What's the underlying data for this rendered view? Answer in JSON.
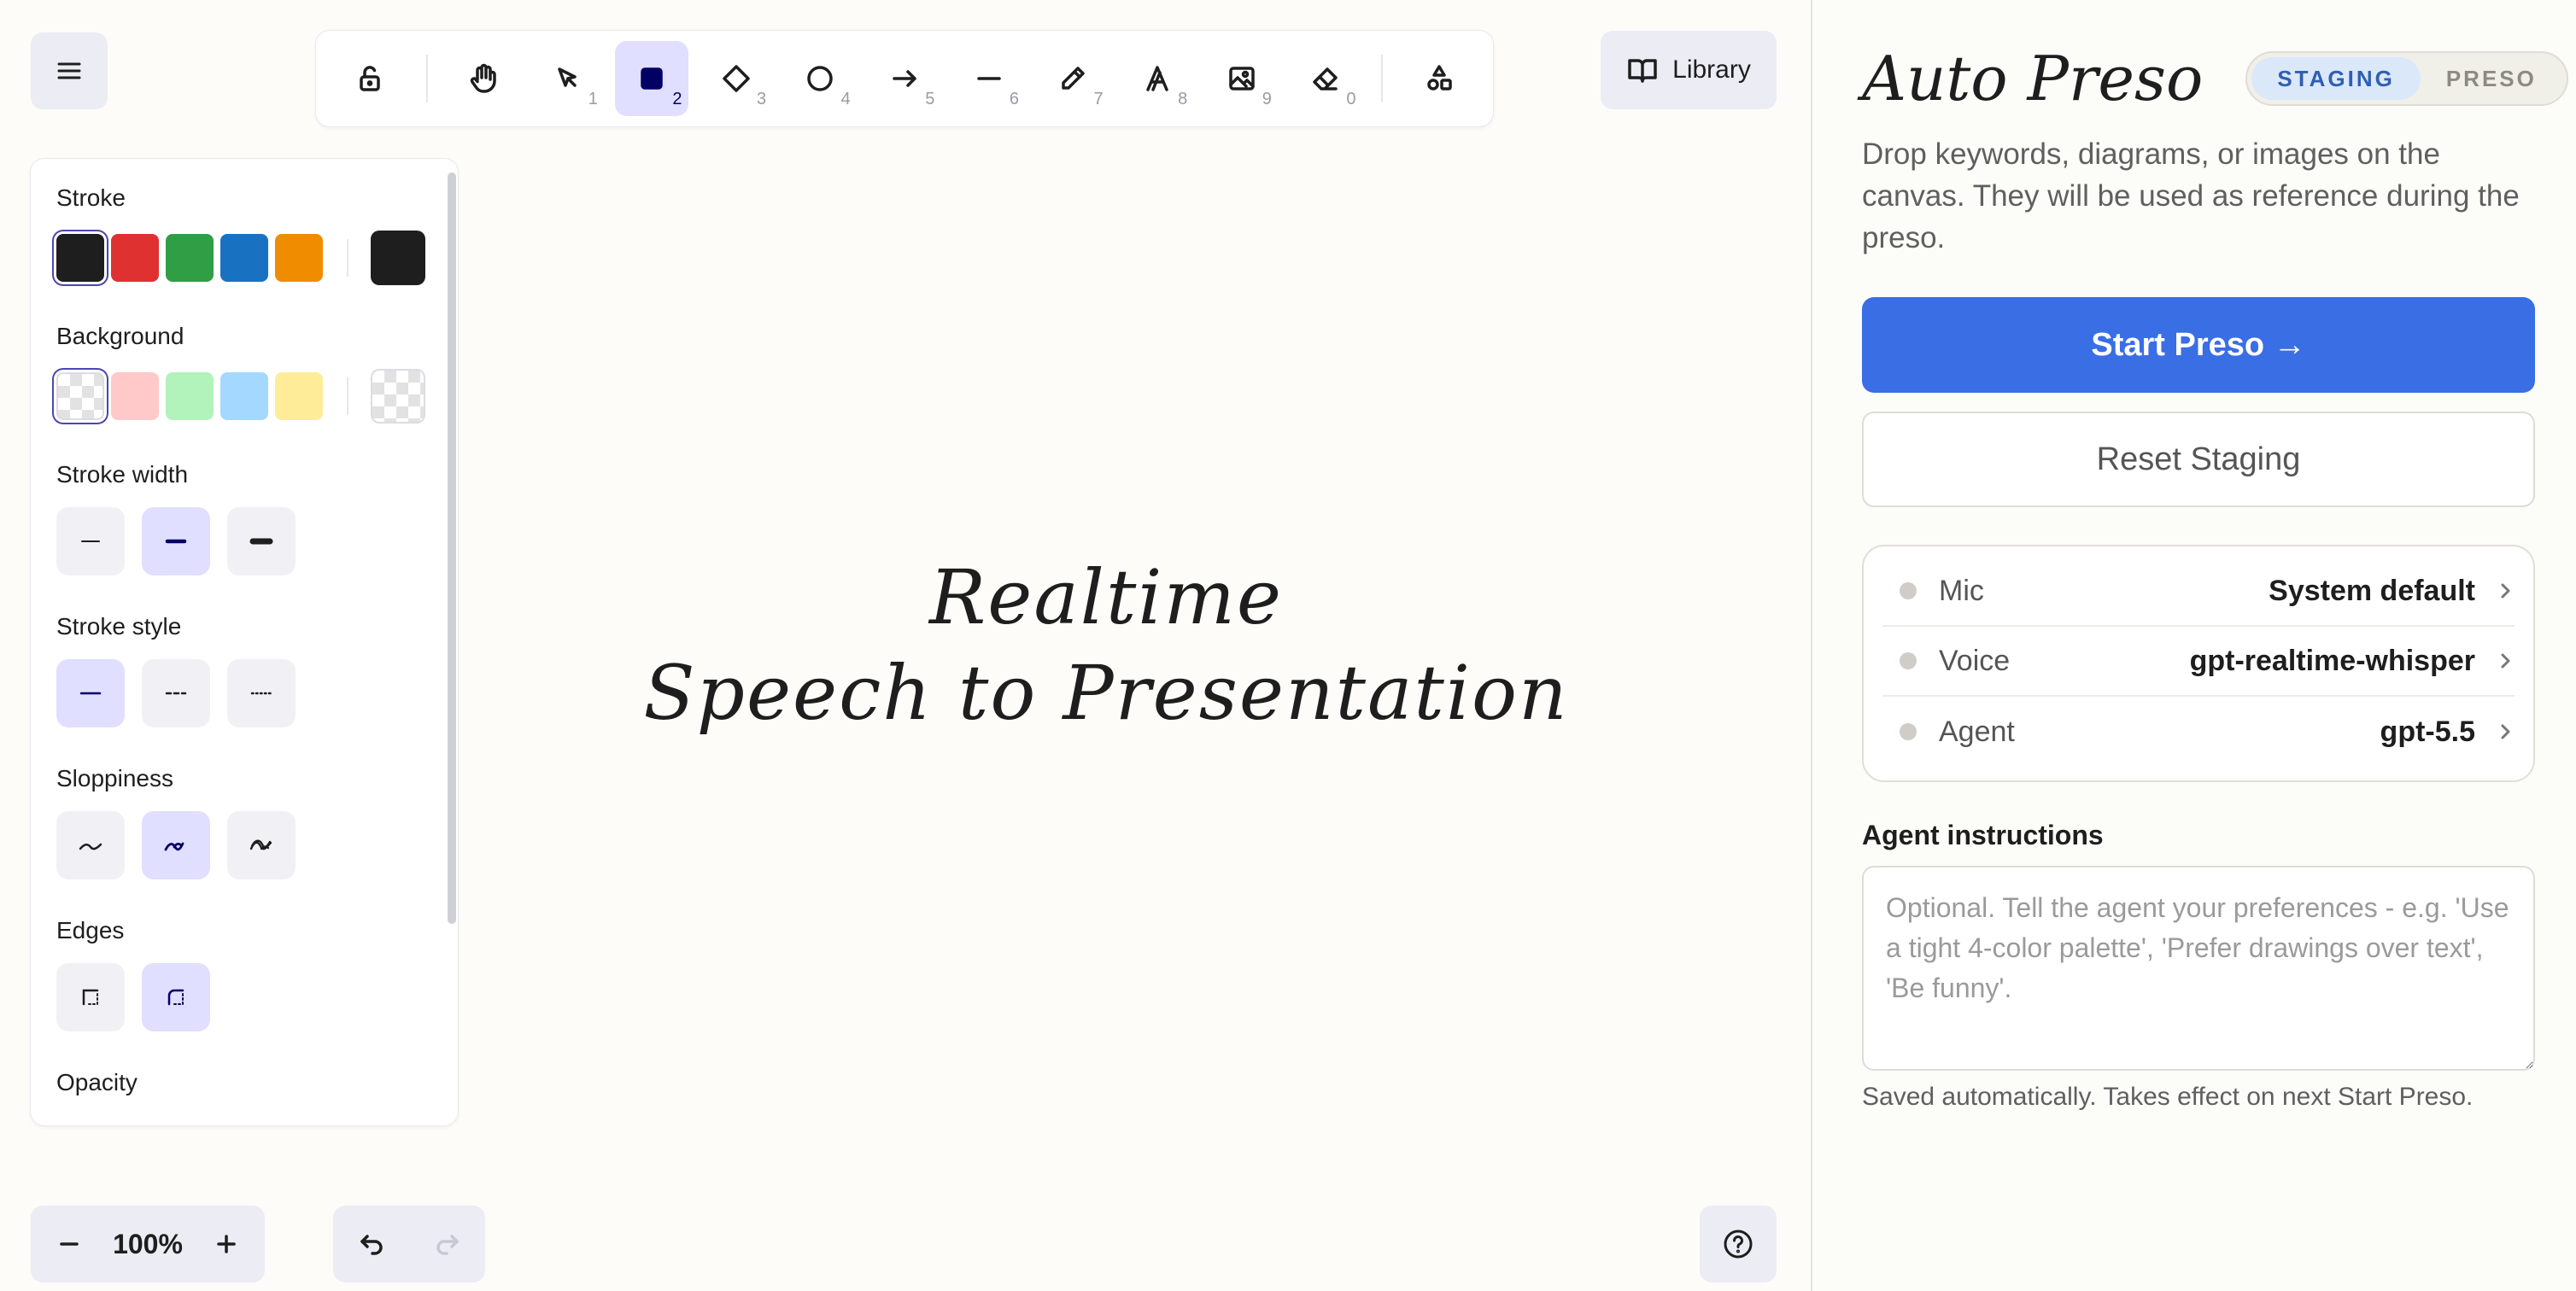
{
  "toolbar": {
    "tools": [
      {
        "name": "lock",
        "key": ""
      },
      {
        "name": "hand",
        "key": ""
      },
      {
        "name": "selection",
        "key": "1"
      },
      {
        "name": "rectangle",
        "key": "2"
      },
      {
        "name": "diamond",
        "key": "3"
      },
      {
        "name": "ellipse",
        "key": "4"
      },
      {
        "name": "arrow",
        "key": "5"
      },
      {
        "name": "line",
        "key": "6"
      },
      {
        "name": "draw",
        "key": "7"
      },
      {
        "name": "text",
        "key": "8"
      },
      {
        "name": "image",
        "key": "9"
      },
      {
        "name": "eraser",
        "key": "0"
      },
      {
        "name": "more-shapes",
        "key": ""
      }
    ],
    "active_tool": "rectangle",
    "library_label": "Library"
  },
  "properties": {
    "stroke_label": "Stroke",
    "stroke_colors": [
      "#1e1e1e",
      "#e03131",
      "#2f9e44",
      "#1971c2",
      "#f08c00"
    ],
    "stroke_current": "#1e1e1e",
    "background_label": "Background",
    "background_colors": [
      "transparent",
      "#ffc9c9",
      "#b2f2bb",
      "#a5d8ff",
      "#ffec99"
    ],
    "background_current": "transparent",
    "stroke_width_label": "Stroke width",
    "stroke_style_label": "Stroke style",
    "sloppiness_label": "Sloppiness",
    "edges_label": "Edges",
    "opacity_label": "Opacity"
  },
  "canvas": {
    "text_line1": "Realtime",
    "text_line2": "Speech to Presentation"
  },
  "zoom": {
    "value": "100%"
  },
  "panel": {
    "brand": "Auto Preso",
    "mode_staging": "STAGING",
    "mode_preso": "PRESO",
    "description": "Drop keywords, diagrams, or images on the canvas. They will be used as reference during the preso.",
    "start_button": "Start Preso →",
    "reset_button": "Reset Staging",
    "settings": [
      {
        "label": "Mic",
        "value": "System default"
      },
      {
        "label": "Voice",
        "value": "gpt-realtime-whisper"
      },
      {
        "label": "Agent",
        "value": "gpt-5.5"
      }
    ],
    "instructions_title": "Agent instructions",
    "instructions_placeholder": "Optional. Tell the agent your preferences - e.g. 'Use a tight 4-color palette', 'Prefer drawings over text', 'Be funny'.",
    "saved_note": "Saved automatically. Takes effect on next Start Preso."
  },
  "colors": {
    "accent": "#3a6ee5",
    "active_tool_bg": "#e0dfff",
    "staging_bg": "#dbe8f9"
  }
}
